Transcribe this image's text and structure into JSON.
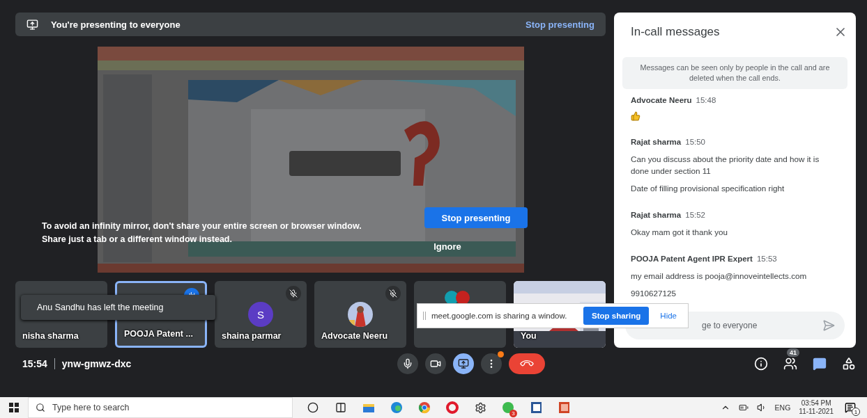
{
  "presenting_banner": {
    "text": "You're presenting to everyone",
    "action": "Stop presenting"
  },
  "mirror_warning": {
    "lines": [
      "To avoid an infinity mirror, don't share your entire screen or browser window.",
      "Share just a tab or a different window instead."
    ],
    "primary": "Stop presenting",
    "secondary": "Ignore"
  },
  "tiles": [
    {
      "name": "nisha sharma",
      "kind": "plain",
      "speaking": false,
      "muted": false
    },
    {
      "name": "POOJA Patent ...",
      "kind": "plain",
      "speaking": true,
      "muted": false
    },
    {
      "name": "shaina parmar",
      "kind": "letter",
      "initial": "S",
      "color": "#5b3cc4",
      "speaking": false,
      "muted": true
    },
    {
      "name": "Advocate Neeru",
      "speaking": false,
      "muted": true
    },
    {
      "kind": "group",
      "speaking": false,
      "muted": false
    },
    {
      "name": "You",
      "kind": "video",
      "speaking": false,
      "muted": false
    }
  ],
  "toast": "Anu Sandhu has left the meeting",
  "share_notice": {
    "text": "meet.google.com is sharing a window.",
    "stop": "Stop sharing",
    "hide": "Hide"
  },
  "chat": {
    "title": "In-call messages",
    "notice": "Messages can be seen only by people in the call and are deleted when the call ends.",
    "messages": [
      {
        "sender": "Advocate Neeru",
        "time": "15:48",
        "kind": "thumbs"
      },
      {
        "sender": "Rajat sharma",
        "time": "15:50",
        "kind": "text",
        "lines": [
          "Can you discuss about the priority date and how it is done under section 11",
          "Date of filling provisional specification right"
        ]
      },
      {
        "sender": "Rajat sharma",
        "time": "15:52",
        "kind": "text",
        "lines": [
          "Okay mam got it thank you"
        ]
      },
      {
        "sender": "POOJA Patent Agent IPR Expert",
        "time": "15:53",
        "kind": "text",
        "lines": [
          "my email address is pooja@innoveintellects.com",
          "9910627125"
        ]
      }
    ],
    "placeholder": "ge to everyone"
  },
  "call_bar": {
    "time": "15:54",
    "code": "ynw-gmwz-dxc",
    "controls": [
      {
        "kind": "mic",
        "selected": false
      },
      {
        "kind": "camera",
        "selected": false
      },
      {
        "kind": "present",
        "selected": true
      },
      {
        "kind": "more",
        "selected": false
      },
      {
        "kind": "end",
        "selected": false
      }
    ],
    "participants_count": "41"
  },
  "taskbar": {
    "search_placeholder": "Type here to search",
    "apps": [
      {
        "kind": "cortana"
      },
      {
        "kind": "taskview"
      },
      {
        "kind": "folder"
      },
      {
        "kind": "edge"
      },
      {
        "kind": "chrome"
      },
      {
        "kind": "opera"
      },
      {
        "kind": "settings"
      },
      {
        "kind": "whatsapp",
        "badge": "3"
      },
      {
        "kind": "word"
      },
      {
        "kind": "powerpoint"
      }
    ],
    "language": "ENG",
    "time": "03:54 PM",
    "date": "11-11-2021",
    "notifications": "1"
  }
}
